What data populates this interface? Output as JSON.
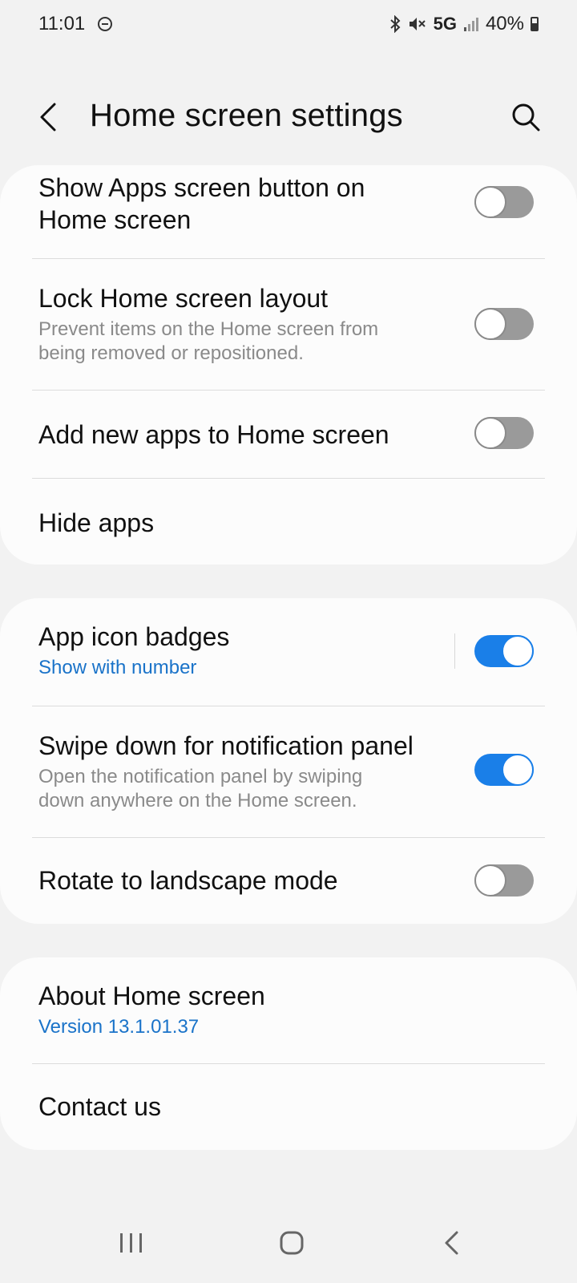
{
  "status_bar": {
    "time": "11:01",
    "network": "5G",
    "battery": "40%"
  },
  "header": {
    "title": "Home screen settings"
  },
  "settings": {
    "show_apps_button": {
      "title_line1": "Show Apps screen button on",
      "title_line2": "Home screen",
      "enabled": false
    },
    "lock_layout": {
      "title": "Lock Home screen layout",
      "sub_line1": "Prevent items on the Home screen from",
      "sub_line2": "being removed or repositioned.",
      "enabled": false
    },
    "add_new_apps": {
      "title": "Add new apps to Home screen",
      "enabled": false
    },
    "hide_apps": {
      "title": "Hide apps"
    },
    "app_icon_badges": {
      "title": "App icon badges",
      "sub": "Show with number",
      "enabled": true
    },
    "swipe_down": {
      "title": "Swipe down for notification panel",
      "sub_line1": "Open the notification panel by swiping",
      "sub_line2": "down anywhere on the Home screen.",
      "enabled": true
    },
    "rotate_landscape": {
      "title": "Rotate to landscape mode",
      "enabled": false
    },
    "about": {
      "title": "About Home screen",
      "version": "Version 13.1.01.37"
    },
    "contact": {
      "title": "Contact us"
    }
  },
  "colors": {
    "accent": "#1a7fe8",
    "link": "#1a73c9",
    "background": "#f2f2f2",
    "card": "#fcfcfc"
  }
}
